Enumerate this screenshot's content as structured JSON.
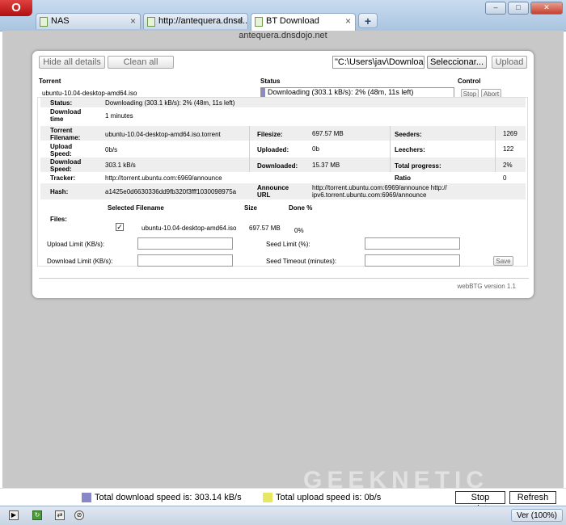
{
  "tabs": [
    {
      "title": "NAS"
    },
    {
      "title": "http://antequera.dnsd..."
    },
    {
      "title": "BT Download"
    }
  ],
  "url": "antequera.dnsdojo.net",
  "toolbar": {
    "hide_details": "Hide all details",
    "clean_all": "Clean all",
    "path_value": "\"C:\\Users\\jav\\Downloads\"",
    "select_button": "Seleccionar...",
    "upload_button": "Upload"
  },
  "headers": {
    "torrent": "Torrent",
    "status": "Status",
    "control": "Control"
  },
  "torrent": {
    "name": "ubuntu-10.04-desktop-amd64.iso",
    "progress_text": "Downloading (303.1 kB/s): 2% (48m, 11s left)",
    "progress_fraction": 0.02,
    "stop": "Stop",
    "abort": "Abort"
  },
  "details": {
    "status_label": "Status:",
    "status_value": "Downloading (303.1 kB/s): 2% (48m, 11s left)",
    "download_time_label_1": "Download",
    "download_time_label_2": "time",
    "download_time_value": "1 minutes",
    "torrent_filename_label_1": "Torrent",
    "torrent_filename_label_2": "Filename:",
    "torrent_filename_value": "ubuntu-10.04-desktop-amd64.iso.torrent",
    "filesize_label": "Filesize:",
    "filesize_value": "697.57 MB",
    "seeders_label": "Seeders:",
    "seeders_value": "1269",
    "upload_speed_label_1": "Upload",
    "upload_speed_label_2": "Speed:",
    "upload_speed_value": "0b/s",
    "uploaded_label": "Uploaded:",
    "uploaded_value": "0b",
    "leechers_label": "Leechers:",
    "leechers_value": "122",
    "download_speed_label_1": "Download",
    "download_speed_label_2": "Speed:",
    "download_speed_value": "303.1 kB/s",
    "downloaded_label": "Downloaded:",
    "downloaded_value": "15.37 MB",
    "total_progress_label": "Total progress:",
    "total_progress_value": "2%",
    "tracker_label": "Tracker:",
    "tracker_value": "http://torrent.ubuntu.com:6969/announce",
    "ratio_label": "Ratio",
    "ratio_value": "0",
    "hash_label": "Hash:",
    "hash_value": "a1425e0d6630336dd9fb320f3fff1030098975a",
    "announce_label_1": "Announce",
    "announce_label_2": "URL",
    "announce_value_1": "http://torrent.ubuntu.com:6969/announce http://",
    "announce_value_2": "ipv6.torrent.ubuntu.com:6969/announce",
    "files_label": "Files:",
    "col_selected_filename": "Selected Filename",
    "col_size": "Size",
    "col_done": "Done %",
    "file_check": "✓",
    "file_name": "ubuntu-10.04-desktop-amd64.iso",
    "file_size": "697.57 MB",
    "file_done": "0%",
    "upload_limit_label": "Upload Limit (KB/s):",
    "download_limit_label": "Download Limit (KB/s):",
    "seed_limit_label": "Seed Limit (%):",
    "seed_timeout_label": "Seed Timeout (minutes):",
    "save_button": "Save"
  },
  "version": "webBTG version 1.1",
  "speedbar": {
    "download_text": "Total download speed is: 303.14 kB/s",
    "upload_text": "Total upload speed is: 0b/s",
    "download_color": "#8888c8",
    "upload_color": "#e8e860",
    "stop_updates": "Stop updates",
    "refresh_now": "Refresh now"
  },
  "watermark": "GEEKNETIC",
  "statusbar": {
    "zoom": "Ver (100%)"
  }
}
